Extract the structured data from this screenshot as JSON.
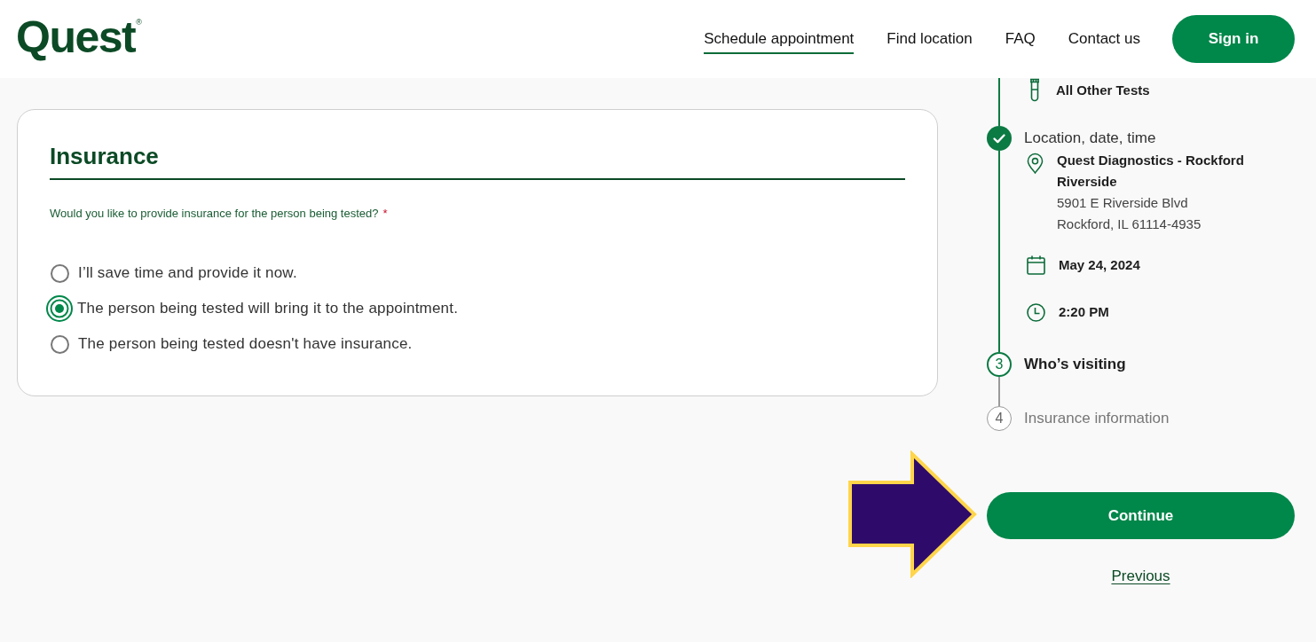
{
  "header": {
    "logo": "Quest$^{®}$",
    "nav": [
      {
        "label": "Schedule appointment",
        "selected": true
      },
      {
        "label": "Find location",
        "selected": false
      },
      {
        "label": "FAQ",
        "selected": false
      },
      {
        "label": "Contact us",
        "selected": false
      }
    ],
    "sign_in": "Sign in"
  },
  "insurance": {
    "title": "Insurance",
    "question": "Would you like to provide insurance for the person being tested?",
    "required_mark": "*",
    "options": [
      {
        "label": "I’ll save time and provide it now.",
        "selected": false
      },
      {
        "label": "The person being tested will bring it to the appointment.",
        "selected": true
      },
      {
        "label": "The person being tested doesn't have insurance.",
        "selected": false
      }
    ]
  },
  "steps": [
    {
      "done": true,
      "current": false,
      "details": [
        {
          "kind": "test",
          "name": "All Other Tests"
        }
      ]
    },
    {
      "title": "Location, date, time",
      "done": true,
      "current": false,
      "details": [
        {
          "kind": "location",
          "name": "Quest Diagnostics - Rockford Riverside",
          "lines": [
            "5901 E Riverside Blvd",
            "Rockford, IL 61114-4935"
          ]
        },
        {
          "kind": "date",
          "name": "May 24, 2024"
        },
        {
          "kind": "time",
          "name": "2:20 PM"
        }
      ]
    },
    {
      "number": "3",
      "title": "Who’s visiting",
      "done": false,
      "current": true
    },
    {
      "number": "4",
      "title": "Insurance information",
      "done": false,
      "current": false
    }
  ],
  "actions": {
    "continue": "Continue",
    "previous": "Previous"
  },
  "annotations": [
    {
      "kind": "arrow"
    }
  ]
}
